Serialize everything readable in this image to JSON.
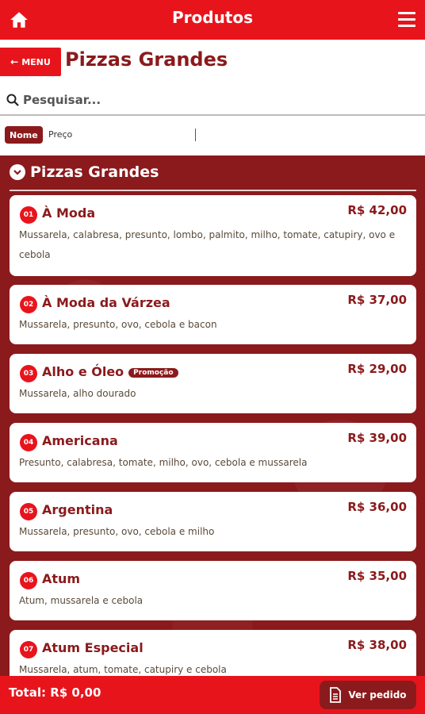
{
  "header": {
    "title": "Produtos",
    "home_icon": "home-icon",
    "menu_icon": "hamburger-icon"
  },
  "subheader": {
    "menu_label": "MENU",
    "page_title": "Pizzas Grandes"
  },
  "search": {
    "placeholder": "Pesquisar..."
  },
  "sort": {
    "nome_label": "Nome",
    "preco_label": "Preço"
  },
  "section": {
    "title": "Pizzas Grandes"
  },
  "products": [
    {
      "num": "01",
      "name": "À Moda",
      "price": "R$ 42,00",
      "desc": "Mussarela, calabresa, presunto, lombo, palmito, milho, tomate, catupiry, ovo e cebola",
      "promo": ""
    },
    {
      "num": "02",
      "name": "À Moda da Várzea",
      "price": "R$ 37,00",
      "desc": "Mussarela, presunto, ovo, cebola e bacon",
      "promo": ""
    },
    {
      "num": "03",
      "name": "Alho e Óleo",
      "price": "R$ 29,00",
      "desc": "Mussarela, alho dourado",
      "promo": "Promoção"
    },
    {
      "num": "04",
      "name": "Americana",
      "price": "R$ 39,00",
      "desc": "Presunto, calabresa, tomate, milho, ovo, cebola e mussarela",
      "promo": ""
    },
    {
      "num": "05",
      "name": "Argentina",
      "price": "R$ 36,00",
      "desc": "Mussarela, presunto, ovo, cebola e milho",
      "promo": ""
    },
    {
      "num": "06",
      "name": "Atum",
      "price": "R$ 35,00",
      "desc": "Atum, mussarela e cebola",
      "promo": ""
    },
    {
      "num": "07",
      "name": "Atum Especial",
      "price": "R$ 38,00",
      "desc": "Mussarela, atum, tomate, catupiry e cebola",
      "promo": ""
    }
  ],
  "footer": {
    "total_label": "Total: R$ 0,00",
    "ver_pedido_label": "Ver pedido"
  },
  "colors": {
    "primary_red": "#e8141c",
    "dark_red": "#8b1a1c"
  }
}
